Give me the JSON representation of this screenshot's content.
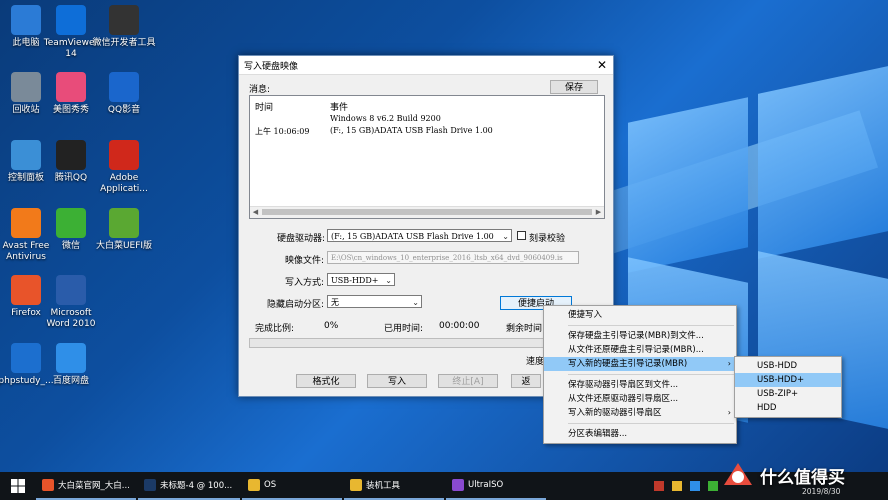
{
  "desktop_icons": [
    {
      "label": "此电脑",
      "icon": "computer-icon",
      "color": "#2b7bd6"
    },
    {
      "label": "TeamViewer 14",
      "icon": "teamviewer-icon",
      "color": "#0e6ed8"
    },
    {
      "label": "微信开发者工具",
      "icon": "terminal-icon",
      "color": "#333333"
    },
    {
      "label": "回收站",
      "icon": "recycle-bin-icon",
      "color": "#7a8a99"
    },
    {
      "label": "美图秀秀",
      "icon": "meitu-icon",
      "color": "#e84c7a"
    },
    {
      "label": "QQ影音",
      "icon": "qqplayer-icon",
      "color": "#1a66cc"
    },
    {
      "label": "控制面板",
      "icon": "control-panel-icon",
      "color": "#3b8fd6"
    },
    {
      "label": "腾讯QQ",
      "icon": "qq-icon",
      "color": "#222222"
    },
    {
      "label": "Adobe Applicati...",
      "icon": "adobe-icon",
      "color": "#d0281b"
    },
    {
      "label": "Avast Free Antivirus",
      "icon": "avast-icon",
      "color": "#f27a1a"
    },
    {
      "label": "微信",
      "icon": "wechat-icon",
      "color": "#3cb034"
    },
    {
      "label": "大白菜UEFI版",
      "icon": "dabaicai-icon",
      "color": "#5aa832"
    },
    {
      "label": "Firefox",
      "icon": "firefox-icon",
      "color": "#e8542a"
    },
    {
      "label": "Microsoft Word 2010",
      "icon": "word-icon",
      "color": "#2a5caa"
    },
    {
      "label": "phpstudy_...",
      "icon": "phpstudy-icon",
      "color": "#1c6fcf"
    },
    {
      "label": "百度网盘",
      "icon": "baidu-netdisk-icon",
      "color": "#2f8fe8"
    }
  ],
  "dialog": {
    "title": "写入硬盘映像",
    "close_glyph": "✕",
    "messages_label": "消息:",
    "save_label": "保存",
    "col_time": "时间",
    "col_event": "事件",
    "rows": [
      {
        "time": "",
        "event": "Windows 8 v6.2 Build 9200"
      },
      {
        "time": "上午 10:06:09",
        "event": "(F:, 15 GB)ADATA   USB Flash Drive 1.00"
      }
    ],
    "drive_label": "硬盘驱动器:",
    "drive_value": "(F:, 15 GB)ADATA   USB Flash Drive 1.00",
    "verify_label": "刻录校验",
    "image_label": "映像文件:",
    "image_value": "E:\\OS\\cn_windows_10_enterprise_2016_ltsb_x64_dvd_9060409.is",
    "method_label": "写入方式:",
    "method_value": "USB-HDD+",
    "hidden_label": "隐藏启动分区:",
    "hidden_value": "无",
    "boot_button": "便捷启动",
    "ratio_label": "完成比例:",
    "ratio_value": "0%",
    "elapsed_label": "已用时间:",
    "elapsed_value": "00:00:00",
    "remain_label": "剩余时间:",
    "speed_label": "速度:",
    "format_button": "格式化",
    "write_button": "写入",
    "stop_button": "终止[A]",
    "back_button": "返"
  },
  "context_menu": {
    "items": [
      {
        "label": "便捷写入",
        "sub": false
      },
      {
        "sep": true
      },
      {
        "label": "保存硬盘主引导记录(MBR)到文件...",
        "sub": false
      },
      {
        "label": "从文件还原硬盘主引导记录(MBR)...",
        "sub": false
      },
      {
        "label": "写入新的硬盘主引导记录(MBR)",
        "sub": true,
        "selected": true
      },
      {
        "sep": true
      },
      {
        "label": "保存驱动器引导扇区到文件...",
        "sub": false
      },
      {
        "label": "从文件还原驱动器引导扇区...",
        "sub": false
      },
      {
        "label": "写入新的驱动器引导扇区",
        "sub": true
      },
      {
        "sep": true
      },
      {
        "label": "分区表编辑器...",
        "sub": false
      }
    ],
    "submenu_glyph": "›"
  },
  "submenu": {
    "items": [
      {
        "label": "USB-HDD"
      },
      {
        "label": "USB-HDD+",
        "selected": true
      },
      {
        "label": "USB-ZIP+"
      },
      {
        "label": "HDD"
      }
    ]
  },
  "taskbar": {
    "items": [
      {
        "label": "大白菜官网_大白...",
        "icon": "firefox-icon",
        "color": "#e8542a",
        "width": 100
      },
      {
        "label": "未标题-4 @ 100...",
        "icon": "photoshop-icon",
        "color": "#1b3a66",
        "width": 102
      },
      {
        "label": "OS",
        "icon": "folder-icon",
        "color": "#e8b730",
        "width": 100
      },
      {
        "label": "装机工具",
        "icon": "folder-icon",
        "color": "#e8b730",
        "width": 100
      },
      {
        "label": "UltraISO",
        "icon": "ultraiso-icon",
        "color": "#8a4ad0",
        "width": 100
      }
    ]
  },
  "watermark": {
    "text": "什么值得买",
    "date": "2019/8/30"
  }
}
